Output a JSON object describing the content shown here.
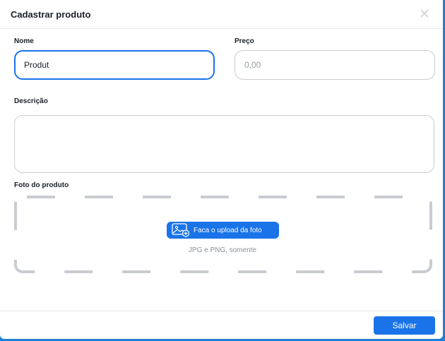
{
  "modal": {
    "title": "Cadastrar produto",
    "close_icon": "close-icon"
  },
  "form": {
    "name": {
      "label": "Nome",
      "value": "Produt"
    },
    "price": {
      "label": "Preço",
      "placeholder": "0,00"
    },
    "description": {
      "label": "Descrição",
      "value": ""
    },
    "photo": {
      "label": "Foto do produto",
      "upload_label": "Faca o upload da foto",
      "upload_icon": "image-add-icon",
      "hint": "JPG e PNG, somente"
    }
  },
  "footer": {
    "save_label": "Salvar"
  },
  "colors": {
    "accent": "#1a73e8",
    "frame": "#1f7fd6",
    "dropzone_border": "#c9ccd1"
  }
}
